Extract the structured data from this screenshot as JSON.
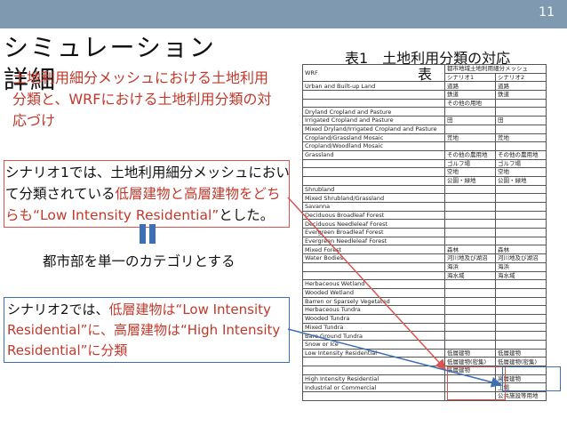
{
  "page_number": "11",
  "slide": {
    "title_line1": "シミュレーション",
    "title_line2": "詳細",
    "intro": "土地利用細分メッシュにおける土地利用分類と、WRFにおける土地利用分類の対応づけ",
    "scenario1_pre": "シナリオ1では、土地利用細分メッシュにおいて分類されている",
    "scenario1_red": "低層建物と高層建物をどちらも“Low Intensity Residential”",
    "scenario1_post": "とした。",
    "urban_single": "都市部を単一のカテゴリとする",
    "scenario2_pre": "シナリオ2では、",
    "scenario2_red": "低層建物は“Low Intensity Residential”に、高層建物は“High Intensity Residential”に分類"
  },
  "table": {
    "caption": "表1　土地利用分類の対応",
    "caption2": "表",
    "header_wrf": "WRF",
    "header_mesh": "都市地域土地利用細分メッシュ",
    "header_s1": "シナリオ1",
    "header_s2": "シナリオ2",
    "rows": [
      {
        "wrf": "Urban and Built-up Land",
        "s1": "道路",
        "s2": "道路"
      },
      {
        "wrf": "",
        "s1": "鉄道",
        "s2": "鉄道"
      },
      {
        "wrf": "",
        "s1": "その他の用地",
        "s2": ""
      },
      {
        "wrf": "Dryland Cropland and Pasture",
        "s1": "",
        "s2": ""
      },
      {
        "wrf": "Irrigated Cropland and Pasture",
        "s1": "田",
        "s2": "田"
      },
      {
        "wrf": "Mixed Dryland/Irrigated Cropland and Pasture",
        "s1": "",
        "s2": ""
      },
      {
        "wrf": "Cropland/Grassland Mosaic",
        "s1": "荒地",
        "s2": "荒地"
      },
      {
        "wrf": "Cropland/Woodland Mosaic",
        "s1": "",
        "s2": ""
      },
      {
        "wrf": "Grassland",
        "s1": "その他の農用地",
        "s2": "その他の農用地"
      },
      {
        "wrf": "",
        "s1": "ゴルフ場",
        "s2": "ゴルフ場"
      },
      {
        "wrf": "",
        "s1": "空地",
        "s2": "空地"
      },
      {
        "wrf": "",
        "s1": "公園・緑地",
        "s2": "公園・緑地"
      },
      {
        "wrf": "Shrubland",
        "s1": "",
        "s2": ""
      },
      {
        "wrf": "Mixed Shrubland/Grassland",
        "s1": "",
        "s2": ""
      },
      {
        "wrf": "Savanna",
        "s1": "",
        "s2": ""
      },
      {
        "wrf": "Deciduous Broadleaf Forest",
        "s1": "",
        "s2": ""
      },
      {
        "wrf": "Deciduous Needleleaf Forest",
        "s1": "",
        "s2": ""
      },
      {
        "wrf": "Evergreen Broadleaf Forest",
        "s1": "",
        "s2": ""
      },
      {
        "wrf": "Evergreen Needleleaf Forest",
        "s1": "",
        "s2": ""
      },
      {
        "wrf": "Mixed Forest",
        "s1": "森林",
        "s2": "森林"
      },
      {
        "wrf": "Water Bodies",
        "s1": "河川地及び湖沼",
        "s2": "河川地及び湖沼"
      },
      {
        "wrf": "",
        "s1": "海浜",
        "s2": "海浜"
      },
      {
        "wrf": "",
        "s1": "海水域",
        "s2": "海水域"
      },
      {
        "wrf": "Herbaceous Wetland",
        "s1": "",
        "s2": ""
      },
      {
        "wrf": "Wooded Wetland",
        "s1": "",
        "s2": ""
      },
      {
        "wrf": "Barren or Sparsely Vegetated",
        "s1": "",
        "s2": ""
      },
      {
        "wrf": "Herbaceous Tundra",
        "s1": "",
        "s2": ""
      },
      {
        "wrf": "Wooded Tundra",
        "s1": "",
        "s2": ""
      },
      {
        "wrf": "Mixed Tundra",
        "s1": "",
        "s2": ""
      },
      {
        "wrf": "Bare Ground Tundra",
        "s1": "",
        "s2": ""
      },
      {
        "wrf": "Snow or Ice",
        "s1": "",
        "s2": ""
      },
      {
        "wrf": "Low Intensity Residential",
        "s1": "低層建物",
        "s2": "低層建物"
      },
      {
        "wrf": "",
        "s1": "低層建物(密集)",
        "s2": "低層建物(密集)"
      },
      {
        "wrf": "",
        "s1": "高層建物",
        "s2": ""
      },
      {
        "wrf": "High Intensity Residential",
        "s1": "",
        "s2": "高層建物"
      },
      {
        "wrf": "Industrial or Commercial",
        "s1": "",
        "s2": "工場"
      },
      {
        "wrf": "",
        "s1": "",
        "s2": "公共施設等用地"
      }
    ]
  },
  "colors": {
    "topbar": "#7f9ab0",
    "red": "#c0392b",
    "blue": "#3d6fb5"
  }
}
